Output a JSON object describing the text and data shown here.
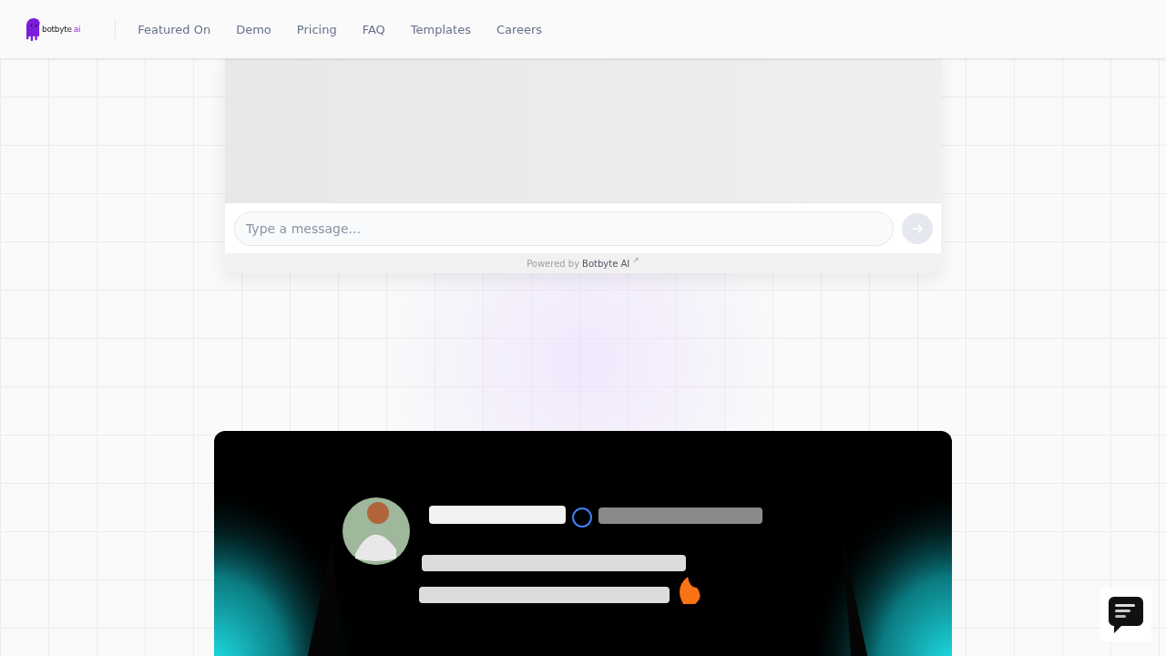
{
  "nav": {
    "brand": {
      "name": "botbyte",
      "suffix": "ai"
    },
    "links": [
      "Featured On",
      "Demo",
      "Pricing",
      "FAQ",
      "Templates",
      "Careers"
    ]
  },
  "chat": {
    "input": {
      "placeholder": "Type a message..."
    },
    "powered_by": {
      "label": "Powered by",
      "link": "Botbyte AI",
      "arrow": "↗"
    }
  }
}
